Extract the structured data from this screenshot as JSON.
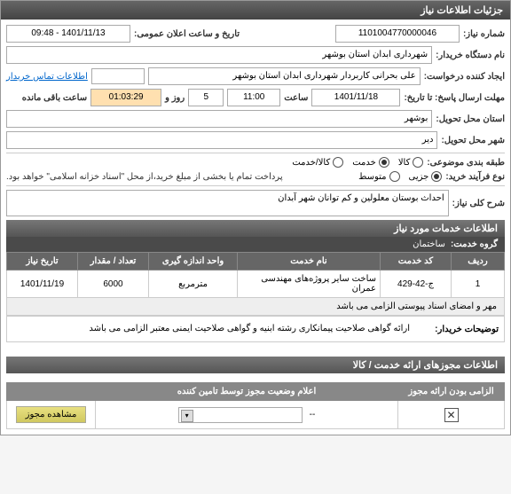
{
  "header": {
    "title": "جزئیات اطلاعات نیاز"
  },
  "fields": {
    "need_number_label": "شماره نیاز:",
    "need_number": "1101004770000046",
    "public_datetime_label": "تاریخ و ساعت اعلان عمومی:",
    "public_datetime": "1401/11/13 - 09:48",
    "buyer_org_label": "نام دستگاه خریدار:",
    "buyer_org": "شهرداری ابدان استان بوشهر",
    "requester_label": "ایجاد کننده درخواست:",
    "requester": "علی بحرانی کاربردار شهرداری ابدان استان بوشهر",
    "contact_link": "اطلاعات تماس خریدار",
    "deadline_label": "مهلت ارسال پاسخ: تا تاریخ:",
    "deadline_date": "1401/11/18",
    "hour_label": "ساعت",
    "deadline_hour": "11:00",
    "days_count": "5",
    "days_label": "روز و",
    "remain_time": "01:03:29",
    "remain_label": "ساعت باقی مانده",
    "province_label": "استان محل تحویل:",
    "province": "بوشهر",
    "city_label": "شهر محل تحویل:",
    "city": "دیر",
    "category_label": "طبقه بندی موضوعی:",
    "type_label": "نوع فرآیند خرید:",
    "payment_note": "پرداخت تمام یا بخشی از مبلغ خرید،از محل \"اسناد خزانه اسلامی\" خواهد بود."
  },
  "radios": {
    "goods": "کالا",
    "service": "خدمت",
    "goods_service": "کالا/خدمت",
    "partial": "جزیی",
    "medium": "متوسط"
  },
  "need_desc": {
    "label": "شرح کلی نیاز:",
    "text": "احداث بوستان معلولین و کم توانان شهر آبدان"
  },
  "services_info_header": "اطلاعات خدمات مورد نیاز",
  "group": {
    "label": "گروه خدمت:",
    "value": "ساختمان"
  },
  "table": {
    "headers": {
      "row": "ردیف",
      "code": "کد خدمت",
      "name": "نام خدمت",
      "unit": "واحد اندازه گیری",
      "qty": "تعداد / مقدار",
      "date": "تاریخ نیاز"
    },
    "rows": [
      {
        "row": "1",
        "code": "ج-42-429",
        "name": "ساخت سایر پروژه‌های مهندسی عمران",
        "unit": "مترمربع",
        "qty": "6000",
        "date": "1401/11/19"
      }
    ],
    "desc": "مهر و امضای اسناد پیوستی الزامی می باشد"
  },
  "buyer_notes": {
    "label": "توضیحات خریدار:",
    "content": "ارائه گواهی صلاحیت پیمانکاری رشته ابنیه و گواهی صلاحیت ایمنی معتبر الزامی می باشد"
  },
  "license_header": "اطلاعات مجوزهای ارائه خدمت / کالا",
  "license_table": {
    "headers": {
      "mandatory": "الزامی بودن ارائه مجوز",
      "status": "اعلام وضعیت مجوز توسط تامین کننده",
      "action": ""
    },
    "status_value": "--",
    "btn": "مشاهده مجوز"
  }
}
